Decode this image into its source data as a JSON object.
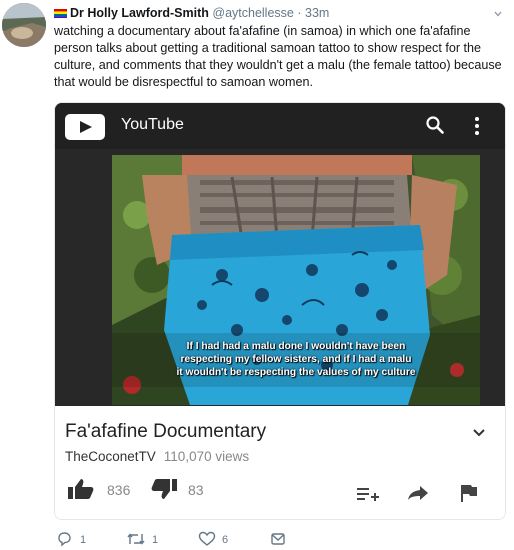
{
  "tweet": {
    "author_name": "Dr Holly Lawford-Smith",
    "handle": "@aytchellesse",
    "separator": "·",
    "time": "33m",
    "text": "watching a documentary about fa'afafine (in samoa) in which one fa'afafine person talks about getting a traditional samoan tattoo to show respect for the culture, and comments that they wouldn't get a malu (the female tattoo) because that would be disrespectful to samoan women."
  },
  "youtube": {
    "brand": "YouTube",
    "subtitle_lines": [
      "If I had had a malu done I wouldn't have been",
      "respecting my fellow sisters, and if I had a malu",
      "it wouldn't be respecting the values of my culture"
    ],
    "video_title": "Fa'afafine Documentary",
    "channel": "TheCoconetTV",
    "views": "110,070 views",
    "likes": "836",
    "dislikes": "83"
  },
  "actions": {
    "replies": "1",
    "retweets": "1",
    "likes": "6"
  },
  "colors": {
    "accent_text": "#14171a",
    "muted": "#657786",
    "youtube_bar": "#212121",
    "lavalava_blue": "#2aa5d8"
  },
  "icons": [
    "rainbow-flag-icon",
    "caret-down-icon",
    "play-icon",
    "search-icon",
    "more-vert-icon",
    "thumbs-up-icon",
    "thumbs-down-icon",
    "add-to-queue-icon",
    "share-arrow-icon",
    "report-flag-icon",
    "reply-icon",
    "retweet-icon",
    "heart-icon",
    "dm-icon"
  ]
}
